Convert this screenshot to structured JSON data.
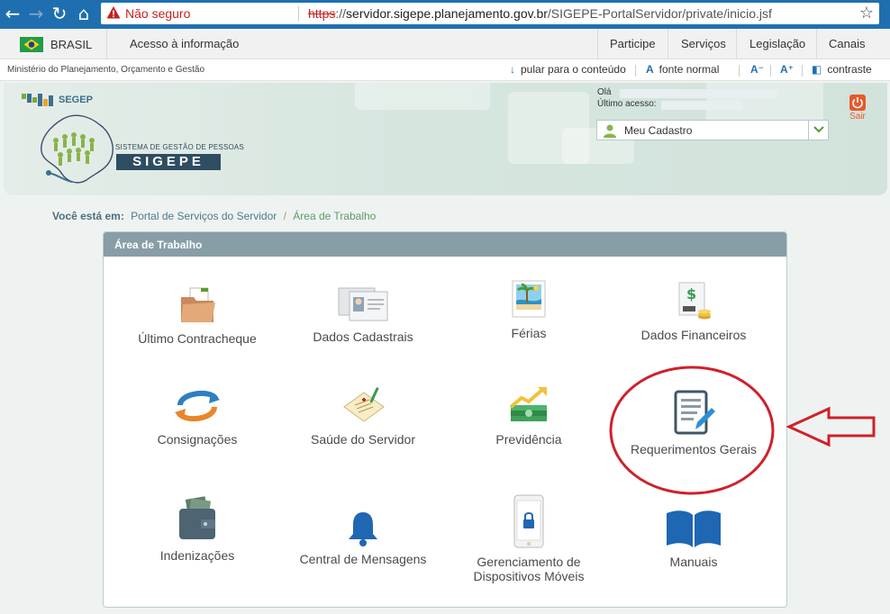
{
  "browser": {
    "security_label": "Não seguro",
    "url_scheme": "https",
    "url_rest_prefix": "://",
    "url_host": "servidor.sigepe.planejamento.gov.br",
    "url_path": "/SIGEPE-PortalServidor/private/inicio.jsf"
  },
  "govbar": {
    "brasil": "BRASIL",
    "acesso": "Acesso à informação",
    "menu": [
      "Participe",
      "Serviços",
      "Legislação",
      "Canais"
    ]
  },
  "accbar": {
    "ministerio": "Ministério do Planejamento, Orçamento e Gestão",
    "skip": "pular para o conteúdo",
    "font_normal": "fonte normal",
    "font_minus": "A⁻",
    "font_plus": "A⁺",
    "contrast": "contraste"
  },
  "header": {
    "segep": "SEGEP",
    "sigep_sub": "SISTEMA DE GESTÃO DE PESSOAS",
    "sigep": "SIGEPE",
    "greeting": "Olá",
    "last_access": "Último acesso:",
    "cadastro": "Meu Cadastro",
    "logout": "Sair"
  },
  "breadcrumb": {
    "label": "Você está em:",
    "portal": "Portal de Serviços do Servidor",
    "separator": "/",
    "current": "Área de Trabalho"
  },
  "panel": {
    "title": "Área de Trabalho",
    "tiles": [
      {
        "label": "Último Contracheque"
      },
      {
        "label": "Dados Cadastrais"
      },
      {
        "label": "Férias"
      },
      {
        "label": "Dados Financeiros"
      },
      {
        "label": "Consignações"
      },
      {
        "label": "Saúde do Servidor"
      },
      {
        "label": "Previdência"
      },
      {
        "label": "Requerimentos Gerais"
      },
      {
        "label": "Indenizações"
      },
      {
        "label": "Central de Mensagens"
      },
      {
        "label": "Gerenciamento de Dispositivos Móveis"
      },
      {
        "label": "Manuais"
      }
    ]
  },
  "colors": {
    "browser_bar": "#1f6fb0",
    "panel_header": "#879ea7",
    "annotation": "#d0202a",
    "link": "#4d7a8a"
  }
}
